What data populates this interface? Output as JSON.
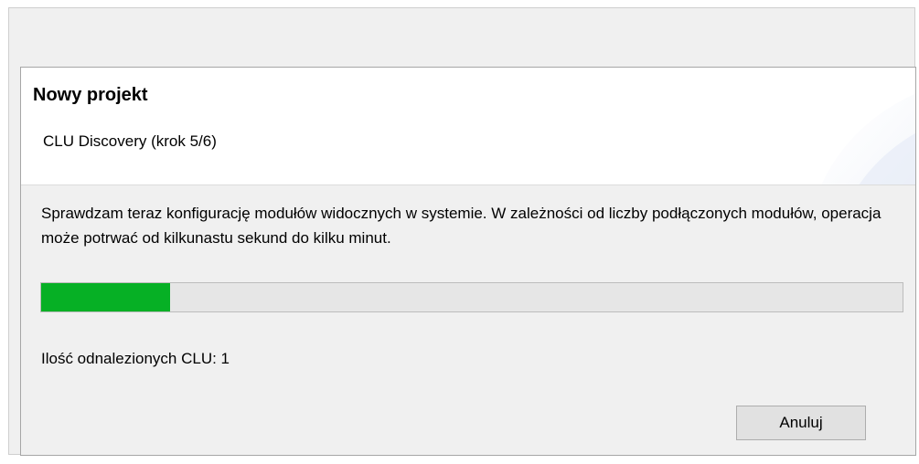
{
  "dialog": {
    "title": "Nowy projekt",
    "subtitle": "CLU Discovery (krok 5/6)",
    "description": "Sprawdzam teraz konfigurację modułów widocznych w systemie. W zależności od liczby podłączonych modułów, operacja może potrwać od kilkunastu sekund do kilku minut.",
    "progress_fraction": 0.15,
    "found_label": "Ilość odnalezionych CLU: 1",
    "cancel_label": "Anuluj"
  },
  "colors": {
    "progress_fill": "#06b025",
    "progress_track": "#e6e6e6"
  }
}
